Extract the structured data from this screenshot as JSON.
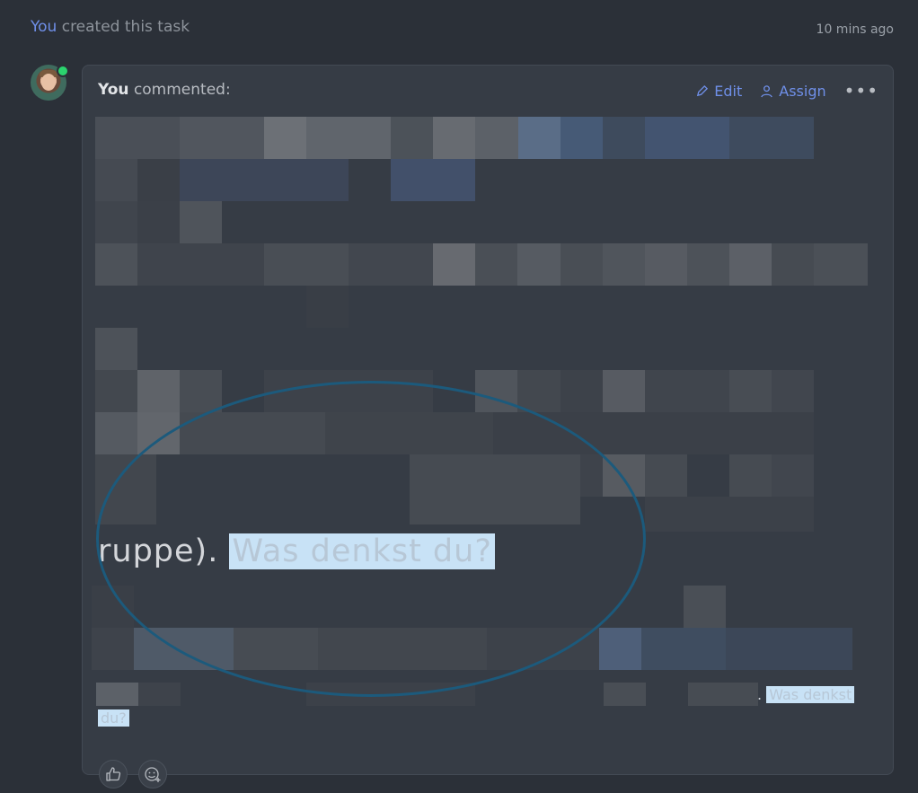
{
  "activity": {
    "actor": "You",
    "text": "created this task",
    "time": "10 mins ago"
  },
  "comment": {
    "author": "You",
    "verb": "commented:",
    "edit_label": "Edit",
    "assign_label": "Assign",
    "more_label": "•••",
    "visible_text": "ruppe).",
    "highlight_text": "Was denkst du?",
    "tail_prefix": ".",
    "tail_highlight_1": "Was denkst",
    "tail_highlight_2": "du?"
  },
  "reactions": {
    "like_icon": "thumbs-up-icon",
    "emoji_icon": "add-emoji-icon"
  },
  "colors": {
    "accent": "#6f8fe8",
    "online": "#2bd46e",
    "highlight": "#c8e2f6",
    "annotation": "#1c5a7c"
  }
}
